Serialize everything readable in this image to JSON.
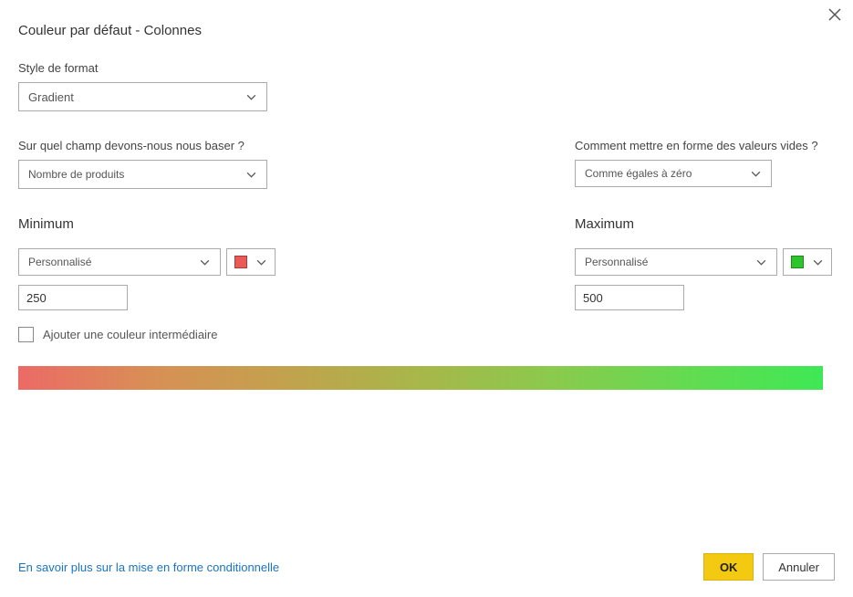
{
  "title": "Couleur par défaut - Colonnes",
  "formatStyle": {
    "label": "Style de format",
    "value": "Gradient"
  },
  "basedOn": {
    "label": "Sur quel champ devons-nous nous baser ?",
    "value": "Nombre de produits"
  },
  "emptyValues": {
    "label": "Comment mettre en forme des valeurs vides ?",
    "value": "Comme égales à zéro"
  },
  "minimum": {
    "heading": "Minimum",
    "mode": "Personnalisé",
    "value": "250",
    "color": "#eb5a56"
  },
  "maximum": {
    "heading": "Maximum",
    "mode": "Personnalisé",
    "value": "500",
    "color": "#2cc62c"
  },
  "midColor": {
    "label": "Ajouter une couleur intermédiaire"
  },
  "footer": {
    "learnMore": "En savoir plus sur la mise en forme conditionnelle",
    "ok": "OK",
    "cancel": "Annuler"
  }
}
